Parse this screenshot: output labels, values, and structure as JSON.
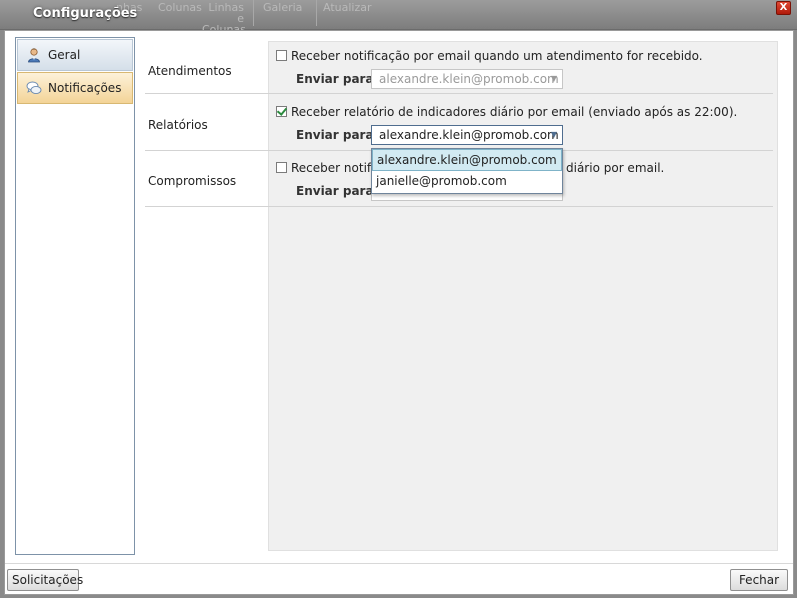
{
  "window": {
    "title": "Configurações",
    "close_label": "X",
    "ribbon_ghost": [
      "nhas",
      "Colunas",
      "Linhas e Colunas",
      "Galeria",
      "Atualizar"
    ]
  },
  "nav": {
    "items": [
      {
        "label": "Geral",
        "icon": "user-icon"
      },
      {
        "label": "Notificações",
        "icon": "chat-bubbles-icon"
      }
    ],
    "selected": "Notificações"
  },
  "sections": [
    {
      "label": "Atendimentos",
      "checked": false,
      "checkbox_label": "Receber notificação por email quando um atendimento for recebido.",
      "send_to_label": "Enviar para",
      "send_to_value": "alexandre.klein@promob.com",
      "enabled": false
    },
    {
      "label": "Relatórios",
      "checked": true,
      "checkbox_label": "Receber relatório de indicadores diário por email (enviado após as 22:00).",
      "send_to_label": "Enviar para",
      "send_to_value": "alexandre.klein@promob.com",
      "enabled": true
    },
    {
      "label": "Compromissos",
      "checked": false,
      "checkbox_label_left": "Receber notific",
      "checkbox_label_right": "diário por email.",
      "send_to_label": "Enviar para",
      "enabled": false
    }
  ],
  "dropdown": {
    "options": [
      "alexandre.klein@promob.com",
      "janielle@promob.com"
    ],
    "highlighted": "alexandre.klein@promob.com"
  },
  "footer": {
    "left_button": "Solicitações",
    "right_button": "Fechar"
  }
}
